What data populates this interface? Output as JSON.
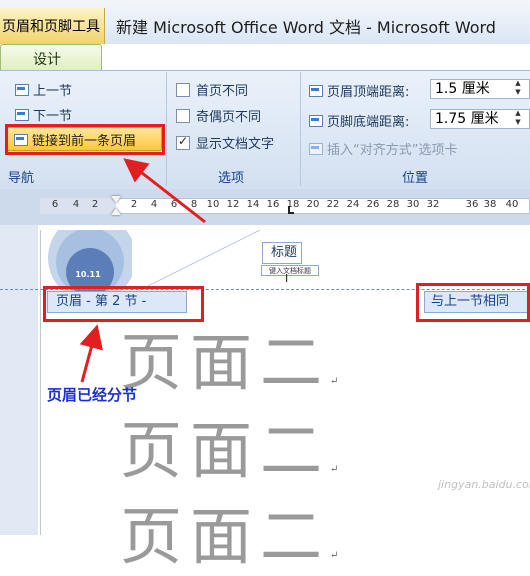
{
  "titlebar": {
    "tool_tab_caption": "页眉和页脚工具",
    "window_title": "新建 Microsoft Office Word 文档 - Microsoft Word"
  },
  "ribbon": {
    "active_tab": "设计",
    "navigation": {
      "group_label": "导航",
      "prev_section": "上一节",
      "next_section": "下一节",
      "link_to_previous": "链接到前一条页眉"
    },
    "options": {
      "group_label": "选项",
      "first_page_different": {
        "label": "首页不同",
        "checked": false
      },
      "odd_even_different": {
        "label": "奇偶页不同",
        "checked": false
      },
      "show_document_text": {
        "label": "显示文档文字",
        "checked": true
      }
    },
    "position": {
      "group_label": "位置",
      "header_from_top_label": "页眉顶端距离:",
      "header_from_top_value": "1.5 厘米",
      "footer_from_bottom_label": "页脚底端距离:",
      "footer_from_bottom_value": "1.75 厘米",
      "insert_alignment_tab": "插入“对齐方式”选项卡"
    }
  },
  "ruler": {
    "ticks": [
      "6",
      "4",
      "2",
      "2",
      "4",
      "6",
      "8",
      "10",
      "12",
      "14",
      "16",
      "18",
      "20",
      "22",
      "24",
      "26",
      "28",
      "30",
      "32",
      "36",
      "38",
      "40"
    ]
  },
  "document": {
    "deco_date": "10.11",
    "title_field": "标题",
    "title_hint": "键入文档标题",
    "header_label": "页眉 - 第 2 节 -",
    "same_as_previous": "与上一节相同",
    "body_lines": [
      "页面二",
      "页面二",
      "页面二"
    ]
  },
  "annotation": {
    "text": "页眉已经分节",
    "color": "#1b2fd6",
    "box_color": "#e02020"
  },
  "watermark": "jingyan.baidu.com",
  "colors": {
    "ribbon_label": "#15428b",
    "tool_tab": "#f1d36b",
    "highlight_button": "#ffc83c"
  }
}
